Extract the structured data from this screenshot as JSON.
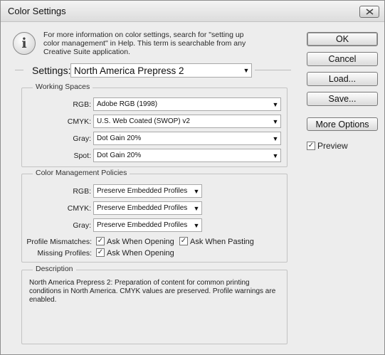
{
  "window": {
    "title": "Color Settings"
  },
  "info": {
    "lines": [
      "For more information on color settings, search for \"setting up",
      "color management\" in Help. This term is searchable from any",
      "Creative Suite application."
    ]
  },
  "buttons": {
    "ok": "OK",
    "cancel": "Cancel",
    "load": "Load...",
    "save": "Save...",
    "more_options": "More Options"
  },
  "preview": {
    "label": "Preview",
    "checked": true
  },
  "settings": {
    "label": "Settings:",
    "value": "North America Prepress 2"
  },
  "working_spaces": {
    "title": "Working Spaces",
    "rows": [
      {
        "label": "RGB:",
        "value": "Adobe RGB (1998)"
      },
      {
        "label": "CMYK:",
        "value": "U.S. Web Coated (SWOP) v2"
      },
      {
        "label": "Gray:",
        "value": "Dot Gain 20%"
      },
      {
        "label": "Spot:",
        "value": "Dot Gain 20%"
      }
    ]
  },
  "policies": {
    "title": "Color Management Policies",
    "rows": [
      {
        "label": "RGB:",
        "value": "Preserve Embedded Profiles"
      },
      {
        "label": "CMYK:",
        "value": "Preserve Embedded Profiles"
      },
      {
        "label": "Gray:",
        "value": "Preserve Embedded Profiles"
      }
    ],
    "profile_mismatches": {
      "label": "Profile Mismatches:",
      "ask_opening": "Ask When Opening",
      "ask_pasting": "Ask When Pasting",
      "ask_opening_checked": true,
      "ask_pasting_checked": true
    },
    "missing_profiles": {
      "label": "Missing Profiles:",
      "ask_opening": "Ask When Opening",
      "ask_opening_checked": true
    }
  },
  "description": {
    "title": "Description",
    "lines": [
      "North America Prepress 2:  Preparation of content for common printing",
      "conditions in North America. CMYK values are preserved. Profile warnings are",
      "enabled."
    ]
  },
  "icons": {
    "info": "info-icon",
    "close": "close-icon",
    "dropdown": "chevron-down-icon",
    "check": "checkmark-icon"
  }
}
